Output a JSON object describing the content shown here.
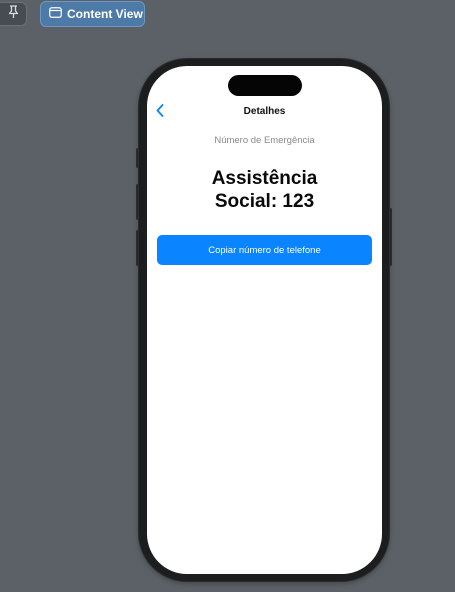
{
  "toolbar": {
    "pin_icon": "pin-icon",
    "content_view_icon": "window-icon",
    "content_view_label": "Content View"
  },
  "phone": {
    "nav": {
      "back_icon": "chevron-left-icon",
      "title": "Detalhes"
    },
    "subtitle": "Número de Emergência",
    "emergency_line1": "Assistência",
    "emergency_line2": "Social: 123",
    "copy_button_label": "Copiar número de telefone"
  },
  "colors": {
    "background": "#5b6166",
    "accent": "#0a84ff",
    "content_view_button": "#4e7aa7"
  }
}
